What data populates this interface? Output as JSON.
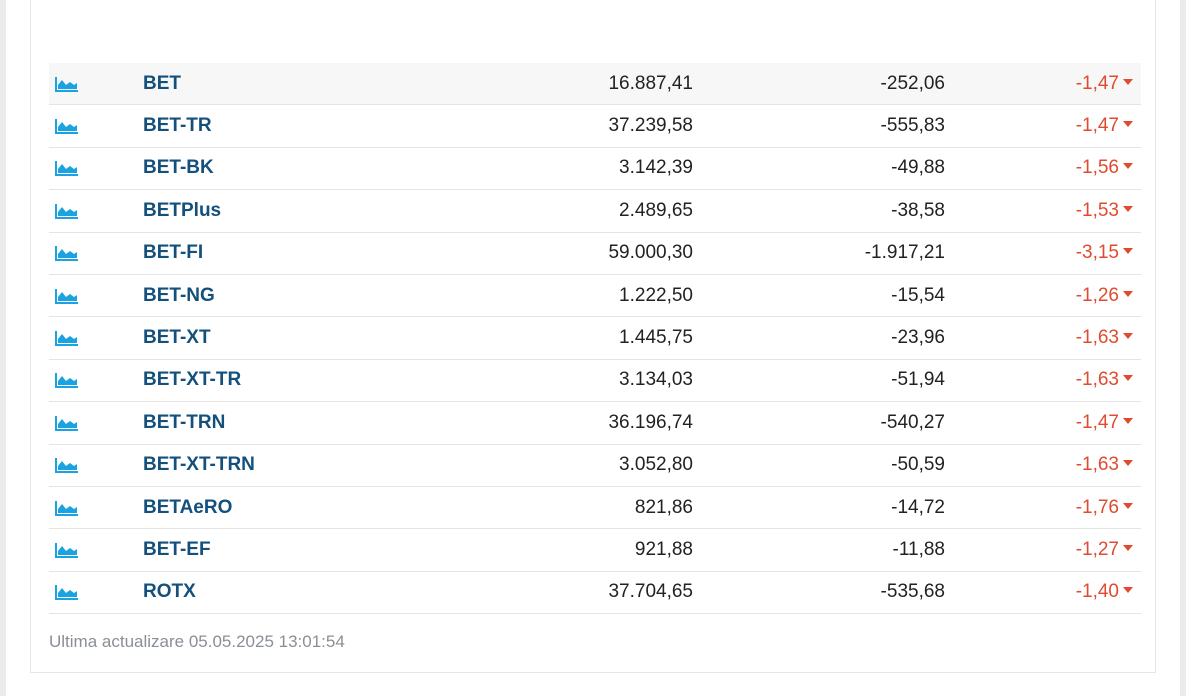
{
  "colors": {
    "index_link": "#14507c",
    "negative": "#e04b2f",
    "chart_icon": "#1aa3e0"
  },
  "rows": [
    {
      "icon": "area-chart-icon",
      "name": "BET",
      "value": "16.887,41",
      "change": "-252,06",
      "pct": "-1,47"
    },
    {
      "icon": "area-chart-icon",
      "name": "BET-TR",
      "value": "37.239,58",
      "change": "-555,83",
      "pct": "-1,47"
    },
    {
      "icon": "area-chart-icon",
      "name": "BET-BK",
      "value": "3.142,39",
      "change": "-49,88",
      "pct": "-1,56"
    },
    {
      "icon": "area-chart-icon",
      "name": "BETPlus",
      "value": "2.489,65",
      "change": "-38,58",
      "pct": "-1,53"
    },
    {
      "icon": "area-chart-icon",
      "name": "BET-FI",
      "value": "59.000,30",
      "change": "-1.917,21",
      "pct": "-3,15"
    },
    {
      "icon": "area-chart-icon",
      "name": "BET-NG",
      "value": "1.222,50",
      "change": "-15,54",
      "pct": "-1,26"
    },
    {
      "icon": "area-chart-icon",
      "name": "BET-XT",
      "value": "1.445,75",
      "change": "-23,96",
      "pct": "-1,63"
    },
    {
      "icon": "area-chart-icon",
      "name": "BET-XT-TR",
      "value": "3.134,03",
      "change": "-51,94",
      "pct": "-1,63"
    },
    {
      "icon": "area-chart-icon",
      "name": "BET-TRN",
      "value": "36.196,74",
      "change": "-540,27",
      "pct": "-1,47"
    },
    {
      "icon": "area-chart-icon",
      "name": "BET-XT-TRN",
      "value": "3.052,80",
      "change": "-50,59",
      "pct": "-1,63"
    },
    {
      "icon": "area-chart-icon",
      "name": "BETAeRO",
      "value": "821,86",
      "change": "-14,72",
      "pct": "-1,76"
    },
    {
      "icon": "area-chart-icon",
      "name": "BET-EF",
      "value": "921,88",
      "change": "-11,88",
      "pct": "-1,27"
    },
    {
      "icon": "area-chart-icon",
      "name": "ROTX",
      "value": "37.704,65",
      "change": "-535,68",
      "pct": "-1,40"
    }
  ],
  "footer": {
    "last_update": "Ultima actualizare 05.05.2025 13:01:54"
  }
}
